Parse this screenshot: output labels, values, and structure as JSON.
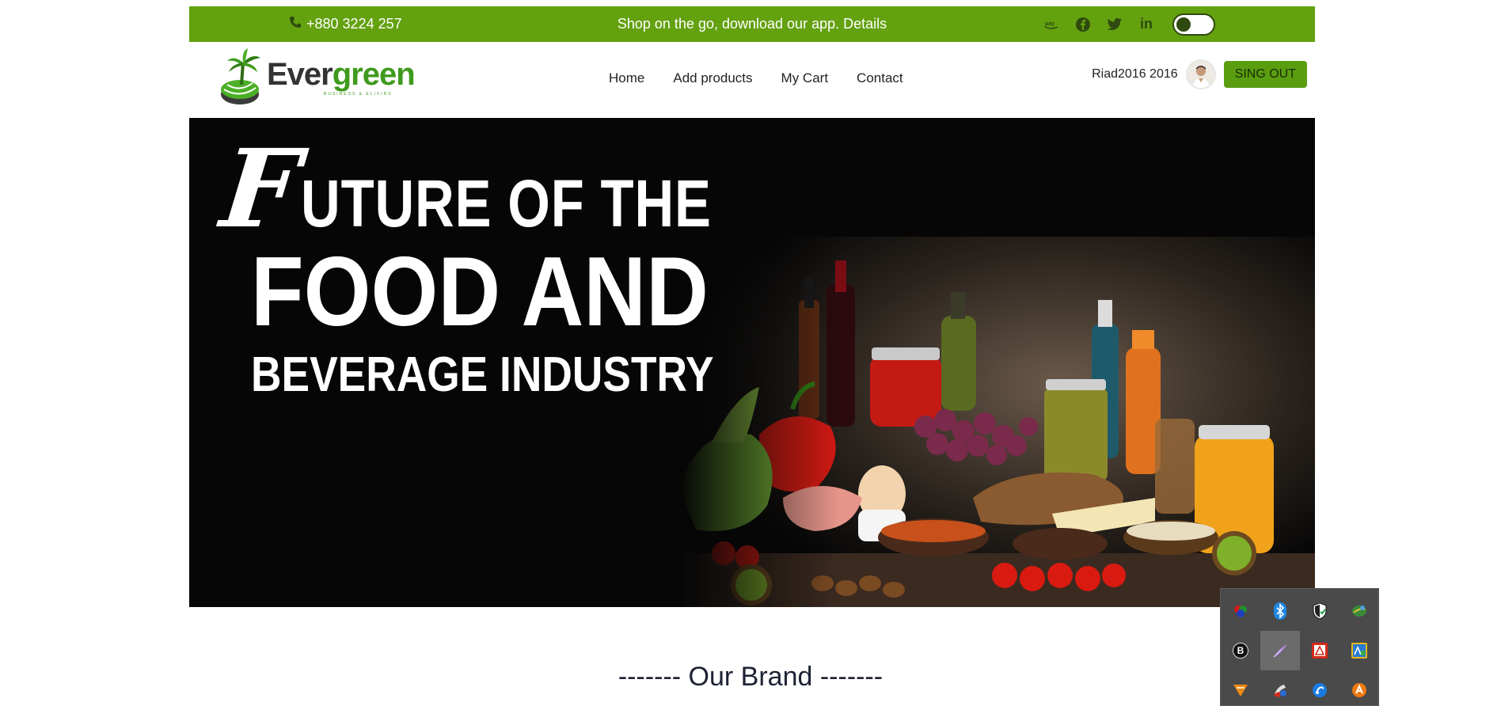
{
  "topbar": {
    "phone": "+880 3224 257",
    "promo": "Shop on the go, download our app. Details",
    "socials": [
      "amazon-pay-icon",
      "facebook-icon",
      "twitter-icon",
      "linkedin-icon"
    ],
    "linkedin_text": "in",
    "theme_toggle": "off",
    "bg_color": "#63a10f"
  },
  "logo": {
    "word_part1": "Ever",
    "word_part2": "green",
    "tagline": "BUSINESS & ELIXIRS"
  },
  "nav": {
    "items": [
      "Home",
      "Add products",
      "My Cart",
      "Contact"
    ]
  },
  "user": {
    "name": "Riad2016 2016",
    "signout_label": "SING OUT",
    "button_color": "#5a9e10"
  },
  "hero": {
    "line1_initial": "F",
    "line1_rest": "UTURE OF THE",
    "line2": "FOOD AND",
    "line3": "BEVERAGE INDUSTRY"
  },
  "brand_section": {
    "title": "------- Our Brand -------"
  },
  "tray": {
    "icons": [
      "color-manager-icon",
      "bluetooth-icon",
      "security-shield-icon",
      "network-globe-icon",
      "b-app-icon",
      "pen-feather-icon",
      "acrobat-icon",
      "image-app-icon",
      "vlc-icon",
      "cleaner-icon",
      "browser-helper-icon",
      "avast-icon"
    ]
  }
}
